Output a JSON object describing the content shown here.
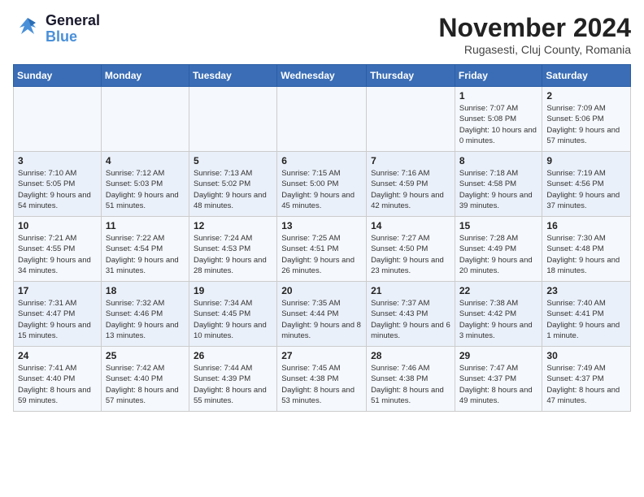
{
  "header": {
    "logo_line1": "General",
    "logo_line2": "Blue",
    "title": "November 2024",
    "subtitle": "Rugasesti, Cluj County, Romania"
  },
  "weekdays": [
    "Sunday",
    "Monday",
    "Tuesday",
    "Wednesday",
    "Thursday",
    "Friday",
    "Saturday"
  ],
  "weeks": [
    [
      {
        "day": "",
        "info": ""
      },
      {
        "day": "",
        "info": ""
      },
      {
        "day": "",
        "info": ""
      },
      {
        "day": "",
        "info": ""
      },
      {
        "day": "",
        "info": ""
      },
      {
        "day": "1",
        "info": "Sunrise: 7:07 AM\nSunset: 5:08 PM\nDaylight: 10 hours and 0 minutes."
      },
      {
        "day": "2",
        "info": "Sunrise: 7:09 AM\nSunset: 5:06 PM\nDaylight: 9 hours and 57 minutes."
      }
    ],
    [
      {
        "day": "3",
        "info": "Sunrise: 7:10 AM\nSunset: 5:05 PM\nDaylight: 9 hours and 54 minutes."
      },
      {
        "day": "4",
        "info": "Sunrise: 7:12 AM\nSunset: 5:03 PM\nDaylight: 9 hours and 51 minutes."
      },
      {
        "day": "5",
        "info": "Sunrise: 7:13 AM\nSunset: 5:02 PM\nDaylight: 9 hours and 48 minutes."
      },
      {
        "day": "6",
        "info": "Sunrise: 7:15 AM\nSunset: 5:00 PM\nDaylight: 9 hours and 45 minutes."
      },
      {
        "day": "7",
        "info": "Sunrise: 7:16 AM\nSunset: 4:59 PM\nDaylight: 9 hours and 42 minutes."
      },
      {
        "day": "8",
        "info": "Sunrise: 7:18 AM\nSunset: 4:58 PM\nDaylight: 9 hours and 39 minutes."
      },
      {
        "day": "9",
        "info": "Sunrise: 7:19 AM\nSunset: 4:56 PM\nDaylight: 9 hours and 37 minutes."
      }
    ],
    [
      {
        "day": "10",
        "info": "Sunrise: 7:21 AM\nSunset: 4:55 PM\nDaylight: 9 hours and 34 minutes."
      },
      {
        "day": "11",
        "info": "Sunrise: 7:22 AM\nSunset: 4:54 PM\nDaylight: 9 hours and 31 minutes."
      },
      {
        "day": "12",
        "info": "Sunrise: 7:24 AM\nSunset: 4:53 PM\nDaylight: 9 hours and 28 minutes."
      },
      {
        "day": "13",
        "info": "Sunrise: 7:25 AM\nSunset: 4:51 PM\nDaylight: 9 hours and 26 minutes."
      },
      {
        "day": "14",
        "info": "Sunrise: 7:27 AM\nSunset: 4:50 PM\nDaylight: 9 hours and 23 minutes."
      },
      {
        "day": "15",
        "info": "Sunrise: 7:28 AM\nSunset: 4:49 PM\nDaylight: 9 hours and 20 minutes."
      },
      {
        "day": "16",
        "info": "Sunrise: 7:30 AM\nSunset: 4:48 PM\nDaylight: 9 hours and 18 minutes."
      }
    ],
    [
      {
        "day": "17",
        "info": "Sunrise: 7:31 AM\nSunset: 4:47 PM\nDaylight: 9 hours and 15 minutes."
      },
      {
        "day": "18",
        "info": "Sunrise: 7:32 AM\nSunset: 4:46 PM\nDaylight: 9 hours and 13 minutes."
      },
      {
        "day": "19",
        "info": "Sunrise: 7:34 AM\nSunset: 4:45 PM\nDaylight: 9 hours and 10 minutes."
      },
      {
        "day": "20",
        "info": "Sunrise: 7:35 AM\nSunset: 4:44 PM\nDaylight: 9 hours and 8 minutes."
      },
      {
        "day": "21",
        "info": "Sunrise: 7:37 AM\nSunset: 4:43 PM\nDaylight: 9 hours and 6 minutes."
      },
      {
        "day": "22",
        "info": "Sunrise: 7:38 AM\nSunset: 4:42 PM\nDaylight: 9 hours and 3 minutes."
      },
      {
        "day": "23",
        "info": "Sunrise: 7:40 AM\nSunset: 4:41 PM\nDaylight: 9 hours and 1 minute."
      }
    ],
    [
      {
        "day": "24",
        "info": "Sunrise: 7:41 AM\nSunset: 4:40 PM\nDaylight: 8 hours and 59 minutes."
      },
      {
        "day": "25",
        "info": "Sunrise: 7:42 AM\nSunset: 4:40 PM\nDaylight: 8 hours and 57 minutes."
      },
      {
        "day": "26",
        "info": "Sunrise: 7:44 AM\nSunset: 4:39 PM\nDaylight: 8 hours and 55 minutes."
      },
      {
        "day": "27",
        "info": "Sunrise: 7:45 AM\nSunset: 4:38 PM\nDaylight: 8 hours and 53 minutes."
      },
      {
        "day": "28",
        "info": "Sunrise: 7:46 AM\nSunset: 4:38 PM\nDaylight: 8 hours and 51 minutes."
      },
      {
        "day": "29",
        "info": "Sunrise: 7:47 AM\nSunset: 4:37 PM\nDaylight: 8 hours and 49 minutes."
      },
      {
        "day": "30",
        "info": "Sunrise: 7:49 AM\nSunset: 4:37 PM\nDaylight: 8 hours and 47 minutes."
      }
    ]
  ]
}
